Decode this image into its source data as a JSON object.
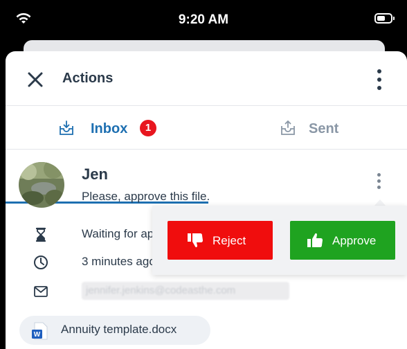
{
  "status_bar": {
    "time": "9:20 AM"
  },
  "header": {
    "title": "Actions"
  },
  "tabs": [
    {
      "label": "Inbox",
      "badge": "1",
      "active": true
    },
    {
      "label": "Sent",
      "active": false
    }
  ],
  "message": {
    "sender": "Jen",
    "text": "Please, approve this file.",
    "status": "Waiting for approval",
    "time_ago": "3 minutes ago",
    "email": "jennifer.jenkins@codeasthe.com"
  },
  "attachment": {
    "name": "Annuity template.docx"
  },
  "popup": {
    "reject_label": "Reject",
    "approve_label": "Approve"
  },
  "colors": {
    "accent": "#1d6fb1",
    "badge": "#e8161f",
    "reject": "#f00d0d",
    "approve": "#1fa320",
    "text": "#2b3a4a"
  }
}
